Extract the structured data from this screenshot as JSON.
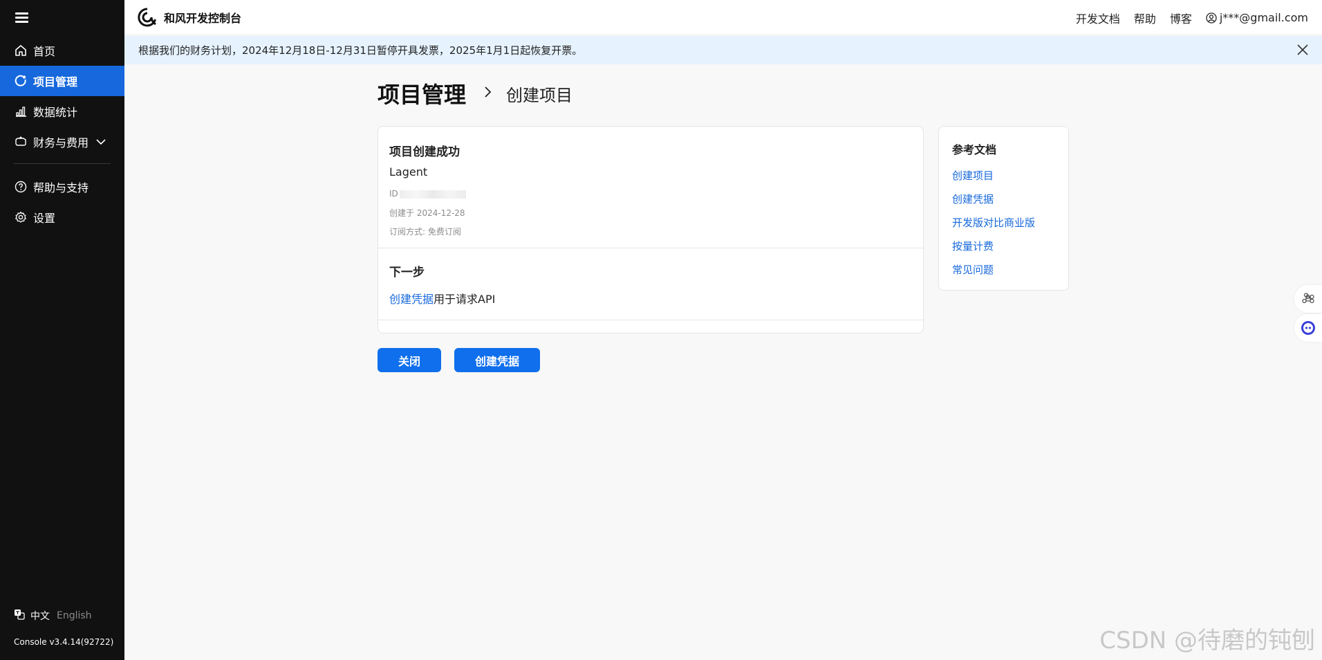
{
  "app": {
    "brand": "和风开发控制台",
    "version": "Console v3.4.14(92722)"
  },
  "sidebar": {
    "items": [
      {
        "label": "首页",
        "icon": "home-icon"
      },
      {
        "label": "项目管理",
        "icon": "project-icon",
        "active": true
      },
      {
        "label": "数据统计",
        "icon": "bar-chart-icon"
      },
      {
        "label": "财务与费用",
        "icon": "wallet-icon",
        "expandable": true
      },
      {
        "label": "帮助与支持",
        "icon": "help-icon"
      },
      {
        "label": "设置",
        "icon": "gear-icon"
      }
    ],
    "lang": {
      "current": "中文",
      "other": "English"
    }
  },
  "topbar": {
    "links": [
      "开发文档",
      "帮助",
      "博客"
    ],
    "user": "j***@gmail.com"
  },
  "notice": {
    "text": "根据我们的财务计划，2024年12月18日-12月31日暂停开具发票，2025年1月1日起恢复开票。"
  },
  "page": {
    "title": "项目管理",
    "subtitle": "创建项目"
  },
  "card": {
    "success_title": "项目创建成功",
    "project_name": "Lagent",
    "id_label": "ID",
    "created": "创建于 2024-12-28",
    "subscription": "订阅方式: 免费订阅",
    "next_title": "下一步",
    "next_link": "创建凭据",
    "next_text": "用于请求API"
  },
  "buttons": {
    "close": "关闭",
    "create_credential": "创建凭据"
  },
  "reference": {
    "title": "参考文档",
    "links": [
      "创建项目",
      "创建凭据",
      "开发版对比商业版",
      "按量计费",
      "常见问题"
    ]
  },
  "watermark": "CSDN @待磨的钝刨",
  "colors": {
    "sidebar_bg": "#111111",
    "active": "#1668dc",
    "button": "#0f6fec",
    "notice_bg": "#e6f3ff"
  }
}
